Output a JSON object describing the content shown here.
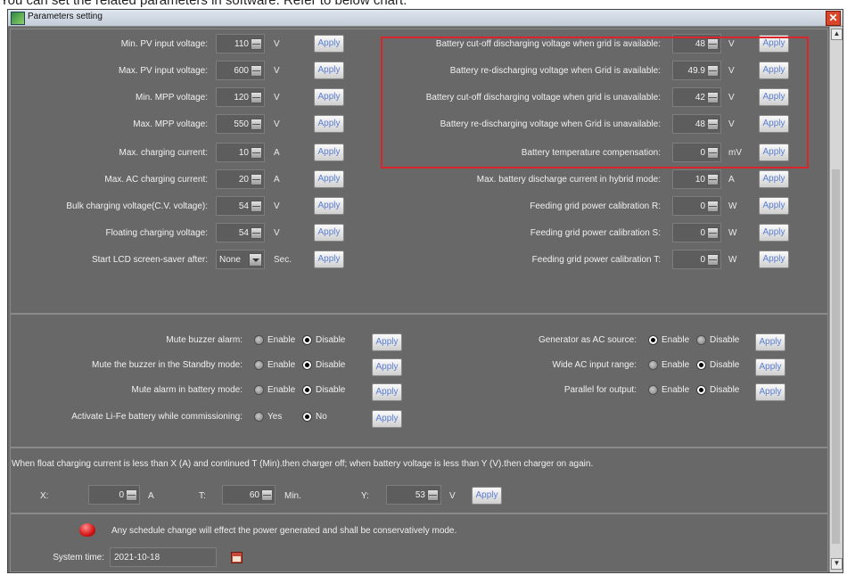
{
  "page_text": "You can set the related parameters in software. Refer to below chart.",
  "window": {
    "title": "Parameters setting",
    "close_glyph": "✕"
  },
  "left_rows": [
    {
      "label": "Min. PV input voltage:",
      "value": "110",
      "unit": "V"
    },
    {
      "label": "Max. PV input voltage:",
      "value": "600",
      "unit": "V"
    },
    {
      "label": "Min. MPP voltage:",
      "value": "120",
      "unit": "V"
    },
    {
      "label": "Max. MPP voltage:",
      "value": "550",
      "unit": "V"
    },
    {
      "label": "Max. charging current:",
      "value": "10",
      "unit": "A"
    },
    {
      "label": "Max. AC charging current:",
      "value": "20",
      "unit": "A"
    },
    {
      "label": "Bulk charging voltage(C.V. voltage):",
      "value": "54",
      "unit": "V"
    },
    {
      "label": "Floating charging voltage:",
      "value": "54",
      "unit": "V"
    },
    {
      "label": "Start LCD screen-saver after:",
      "value": "None",
      "unit": "Sec."
    }
  ],
  "right_rows": [
    {
      "label": "Battery cut-off discharging voltage when grid is available:",
      "value": "48",
      "unit": "V"
    },
    {
      "label": "Battery re-discharging voltage when Grid is available:",
      "value": "49.9",
      "unit": "V"
    },
    {
      "label": "Battery cut-off discharging voltage when grid is unavailable:",
      "value": "42",
      "unit": "V"
    },
    {
      "label": "Battery re-discharging voltage when Grid is unavailable:",
      "value": "48",
      "unit": "V"
    },
    {
      "label": "Battery temperature compensation:",
      "value": "0",
      "unit": "mV"
    },
    {
      "label": "Max. battery discharge current in hybrid mode:",
      "value": "10",
      "unit": "A"
    },
    {
      "label": "Feeding grid power calibration R:",
      "value": "0",
      "unit": "W"
    },
    {
      "label": "Feeding grid power calibration S:",
      "value": "0",
      "unit": "W"
    },
    {
      "label": "Feeding grid power calibration T:",
      "value": "0",
      "unit": "W"
    }
  ],
  "apply_label": "Apply",
  "options_left": [
    {
      "label": "Mute buzzer alarm:",
      "opt1": "Enable",
      "opt2": "Disable",
      "selected": "Disable"
    },
    {
      "label": "Mute the buzzer in the Standby mode:",
      "opt1": "Enable",
      "opt2": "Disable",
      "selected": "Disable"
    },
    {
      "label": "Mute alarm in battery mode:",
      "opt1": "Enable",
      "opt2": "Disable",
      "selected": "Disable"
    },
    {
      "label": "Activate Li-Fe battery while commissioning:",
      "opt1": "Yes",
      "opt2": "No",
      "selected": "No"
    }
  ],
  "options_right": [
    {
      "label": "Generator as AC source:",
      "opt1": "Enable",
      "opt2": "Disable",
      "selected": "Enable"
    },
    {
      "label": "Wide AC input range:",
      "opt1": "Enable",
      "opt2": "Disable",
      "selected": "Disable"
    },
    {
      "label": "Parallel for output:",
      "opt1": "Enable",
      "opt2": "Disable",
      "selected": "Disable"
    }
  ],
  "charger": {
    "description": "When float charging current is less than X (A) and continued T (Min).then charger off; when battery voltage is less than Y (V).then charger on again.",
    "x_label": "X:",
    "x_value": "0",
    "x_unit": "A",
    "t_label": "T:",
    "t_value": "60",
    "t_unit": "Min.",
    "y_label": "Y:",
    "y_value": "53",
    "y_unit": "V"
  },
  "notice": "Any schedule change will effect the power generated and shall be conservatively mode.",
  "system_time": {
    "label": "System time:",
    "value": "2021-10-18"
  },
  "colors": {
    "highlight_box": "#d8262a",
    "apply_text": "#5a7fd1",
    "panel_bg": "#6b6b6b"
  }
}
